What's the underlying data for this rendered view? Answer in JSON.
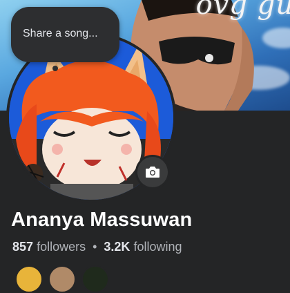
{
  "cover": {
    "overlay_text": "ovg gu"
  },
  "note": {
    "placeholder": "Share a song..."
  },
  "profile": {
    "name": "Ananya Massuwan"
  },
  "stats": {
    "followers_count": "857",
    "followers_label": "followers",
    "separator": "•",
    "following_count": "3.2K",
    "following_label": "following"
  },
  "icons": {
    "camera": "camera-icon"
  },
  "colors": {
    "background": "#242526",
    "text_primary": "#ffffff",
    "text_secondary": "#b0b3b8",
    "button": "#3a3b3c"
  }
}
